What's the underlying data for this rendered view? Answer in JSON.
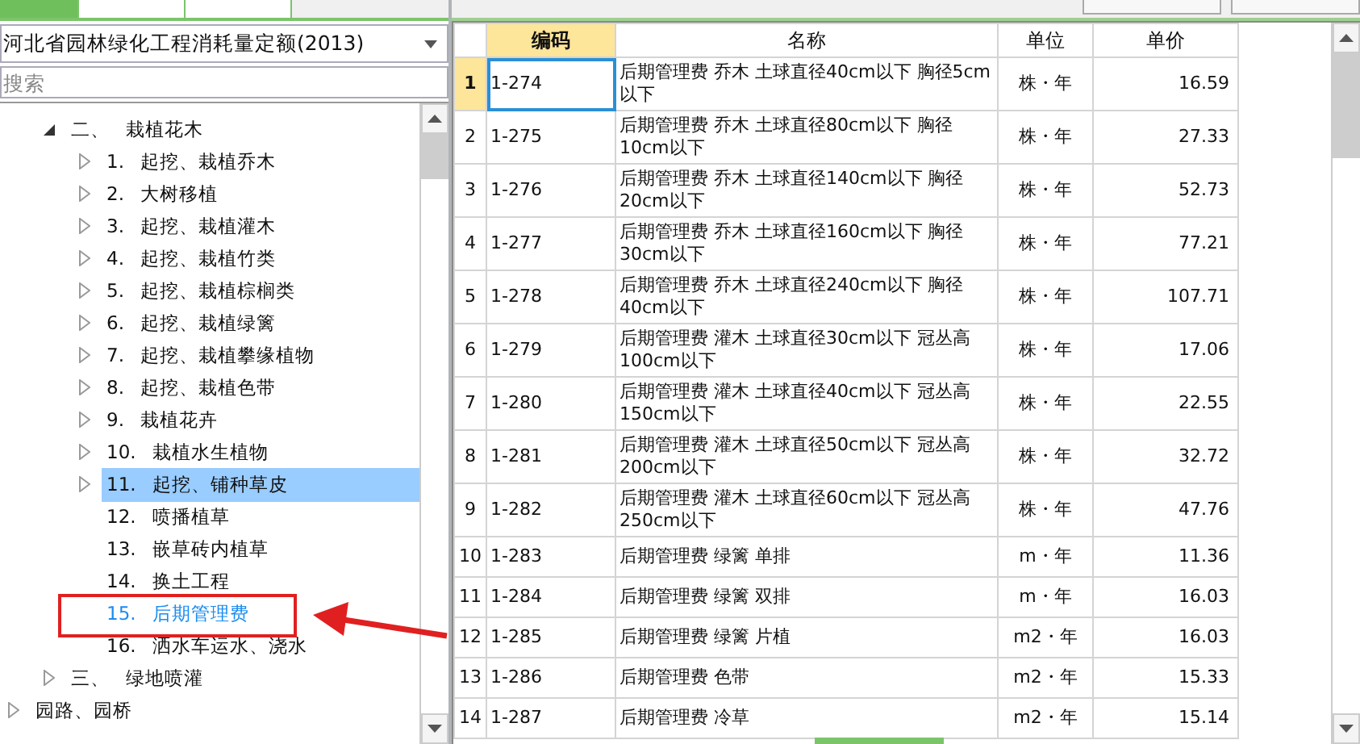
{
  "tabs": [
    {
      "selected": true
    },
    {
      "selected": false
    },
    {
      "selected": false
    }
  ],
  "source_dropdown": {
    "value": "河北省园林绿化工程消耗量定额(2013)"
  },
  "search": {
    "placeholder": "搜索"
  },
  "tree": {
    "items": [
      {
        "children": [
          {
            "number": "二、",
            "label": "栽植花木",
            "expanded": true,
            "selected": false,
            "highlighted": false,
            "children": [
              {
                "number": "1.",
                "label": "起挖、栽植乔木",
                "expanded": false,
                "selected": false,
                "highlighted": false
              },
              {
                "number": "2.",
                "label": "大树移植",
                "expanded": false,
                "selected": false,
                "highlighted": false
              },
              {
                "number": "3.",
                "label": "起挖、栽植灌木",
                "expanded": false,
                "selected": false,
                "highlighted": false
              },
              {
                "number": "4.",
                "label": "起挖、栽植竹类",
                "expanded": false,
                "selected": false,
                "highlighted": false
              },
              {
                "number": "5.",
                "label": "起挖、栽植棕榈类",
                "expanded": false,
                "selected": false,
                "highlighted": false
              },
              {
                "number": "6.",
                "label": "起挖、栽植绿篱",
                "expanded": false,
                "selected": false,
                "highlighted": false
              },
              {
                "number": "7.",
                "label": "起挖、栽植攀缘植物",
                "expanded": false,
                "selected": false,
                "highlighted": false
              },
              {
                "number": "8.",
                "label": "起挖、栽植色带",
                "expanded": false,
                "selected": false,
                "highlighted": false
              },
              {
                "number": "9.",
                "label": "栽植花卉",
                "expanded": false,
                "selected": false,
                "highlighted": false
              },
              {
                "number": "10.",
                "label": "栽植水生植物",
                "expanded": false,
                "selected": false,
                "highlighted": false
              },
              {
                "number": "11.",
                "label": "起挖、铺种草皮",
                "expanded": false,
                "selected": true,
                "highlighted": false
              },
              {
                "number": "12.",
                "label": "喷播植草",
                "selected": false,
                "highlighted": false
              },
              {
                "number": "13.",
                "label": "嵌草砖内植草",
                "selected": false,
                "highlighted": false
              },
              {
                "number": "14.",
                "label": "换土工程",
                "selected": false,
                "highlighted": false
              },
              {
                "number": "15.",
                "label": "后期管理费",
                "selected": false,
                "highlighted": true
              },
              {
                "number": "16.",
                "label": "洒水车运水、浇水",
                "selected": false,
                "highlighted": false
              }
            ]
          },
          {
            "number": "三、",
            "label": "绿地喷灌",
            "expanded": false,
            "selected": false,
            "highlighted": false
          }
        ]
      },
      {
        "label": "园路、园桥",
        "expanded": false,
        "selected": false,
        "highlighted": false
      }
    ]
  },
  "table": {
    "columns": [
      {
        "label": "编码",
        "selected": true
      },
      {
        "label": "名称",
        "selected": false
      },
      {
        "label": "单位",
        "selected": false
      },
      {
        "label": "单价",
        "selected": false
      }
    ],
    "rows": [
      {
        "number": "1",
        "code": "1-274",
        "name": "后期管理费 乔木 土球直径40cm以下 胸径5cm以下",
        "unit": "株・年",
        "price": "16.59",
        "selected": true
      },
      {
        "number": "2",
        "code": "1-275",
        "name": "后期管理费 乔木 土球直径80cm以下 胸径10cm以下",
        "unit": "株・年",
        "price": "27.33",
        "selected": false
      },
      {
        "number": "3",
        "code": "1-276",
        "name": "后期管理费 乔木 土球直径140cm以下 胸径20cm以下",
        "unit": "株・年",
        "price": "52.73",
        "selected": false
      },
      {
        "number": "4",
        "code": "1-277",
        "name": "后期管理费 乔木 土球直径160cm以下 胸径30cm以下",
        "unit": "株・年",
        "price": "77.21",
        "selected": false
      },
      {
        "number": "5",
        "code": "1-278",
        "name": "后期管理费 乔木 土球直径240cm以下 胸径40cm以下",
        "unit": "株・年",
        "price": "107.71",
        "selected": false
      },
      {
        "number": "6",
        "code": "1-279",
        "name": "后期管理费 灌木 土球直径30cm以下 冠丛高100cm以下",
        "unit": "株・年",
        "price": "17.06",
        "selected": false
      },
      {
        "number": "7",
        "code": "1-280",
        "name": "后期管理费 灌木 土球直径40cm以下 冠丛高150cm以下",
        "unit": "株・年",
        "price": "22.55",
        "selected": false
      },
      {
        "number": "8",
        "code": "1-281",
        "name": "后期管理费 灌木 土球直径50cm以下 冠丛高200cm以下",
        "unit": "株・年",
        "price": "32.72",
        "selected": false
      },
      {
        "number": "9",
        "code": "1-282",
        "name": "后期管理费 灌木 土球直径60cm以下 冠丛高250cm以下",
        "unit": "株・年",
        "price": "47.76",
        "selected": false
      },
      {
        "number": "10",
        "code": "1-283",
        "name": "后期管理费 绿篱 单排",
        "unit": "m・年",
        "price": "11.36",
        "selected": false
      },
      {
        "number": "11",
        "code": "1-284",
        "name": "后期管理费 绿篱 双排",
        "unit": "m・年",
        "price": "16.03",
        "selected": false
      },
      {
        "number": "12",
        "code": "1-285",
        "name": "后期管理费 绿篱 片植",
        "unit": "m2・年",
        "price": "16.03",
        "selected": false
      },
      {
        "number": "13",
        "code": "1-286",
        "name": "后期管理费 色带",
        "unit": "m2・年",
        "price": "15.33",
        "selected": false
      },
      {
        "number": "14",
        "code": "1-287",
        "name": "后期管理费 冷草",
        "unit": "m2・年",
        "price": "15.14",
        "selected": false
      }
    ]
  }
}
